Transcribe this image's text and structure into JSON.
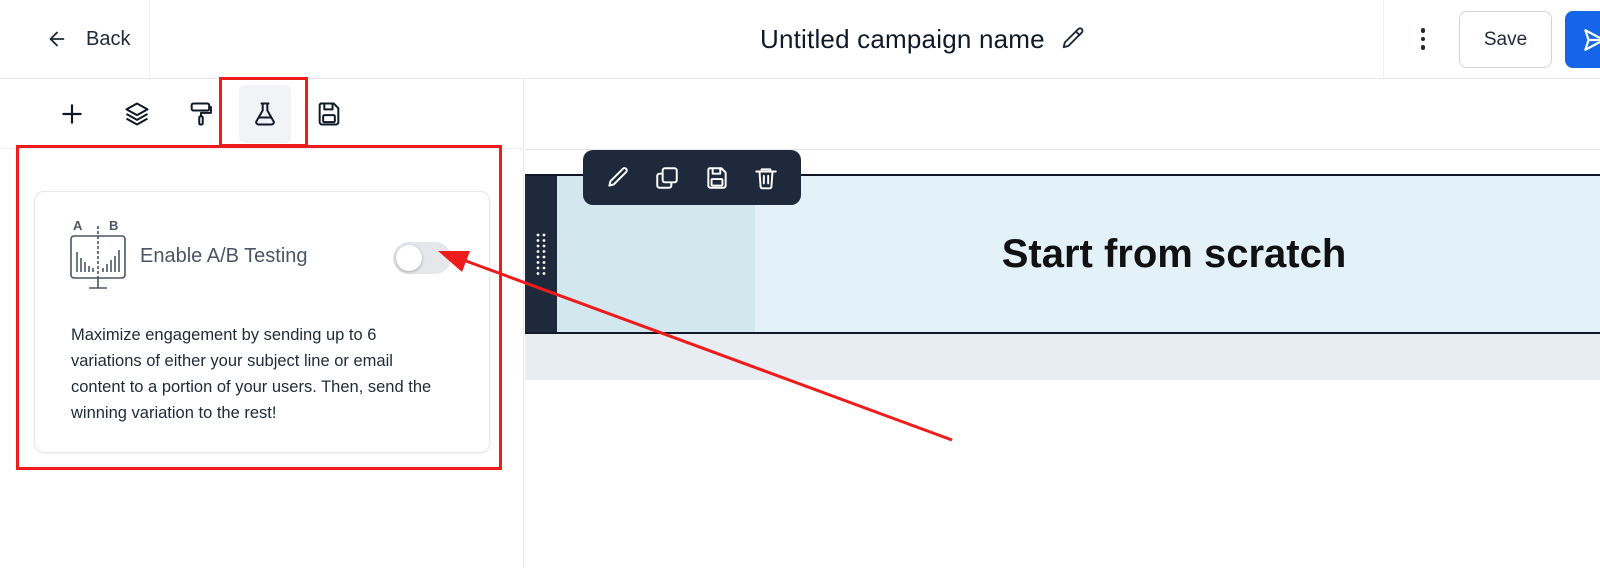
{
  "header": {
    "back_label": "Back",
    "title": "Untitled campaign name",
    "save_label": "Save"
  },
  "toolbar": {
    "tools": [
      "plus-icon",
      "layers-icon",
      "paint-roller-icon",
      "flask-icon",
      "floppy-disk-icon"
    ],
    "active_tool": "flask-icon"
  },
  "ab_card": {
    "label": "Enable A/B Testing",
    "icon_letters": [
      "A",
      "B"
    ],
    "toggle_on": false,
    "description": "Maximize engagement by sending up to 6 variations of either your subject line or email content to a portion of your users. Then, send the winning variation to the rest!"
  },
  "canvas": {
    "block_title": "Start from scratch",
    "block_toolbar": [
      "pencil-icon",
      "duplicate-icon",
      "floppy-disk-icon",
      "trash-icon"
    ]
  },
  "colors": {
    "accent_blue": "#1565e8",
    "annotation_red": "#ee1c1c",
    "dark_toolbar": "#1e2a3b",
    "block_bg": "#e3f2f8"
  }
}
